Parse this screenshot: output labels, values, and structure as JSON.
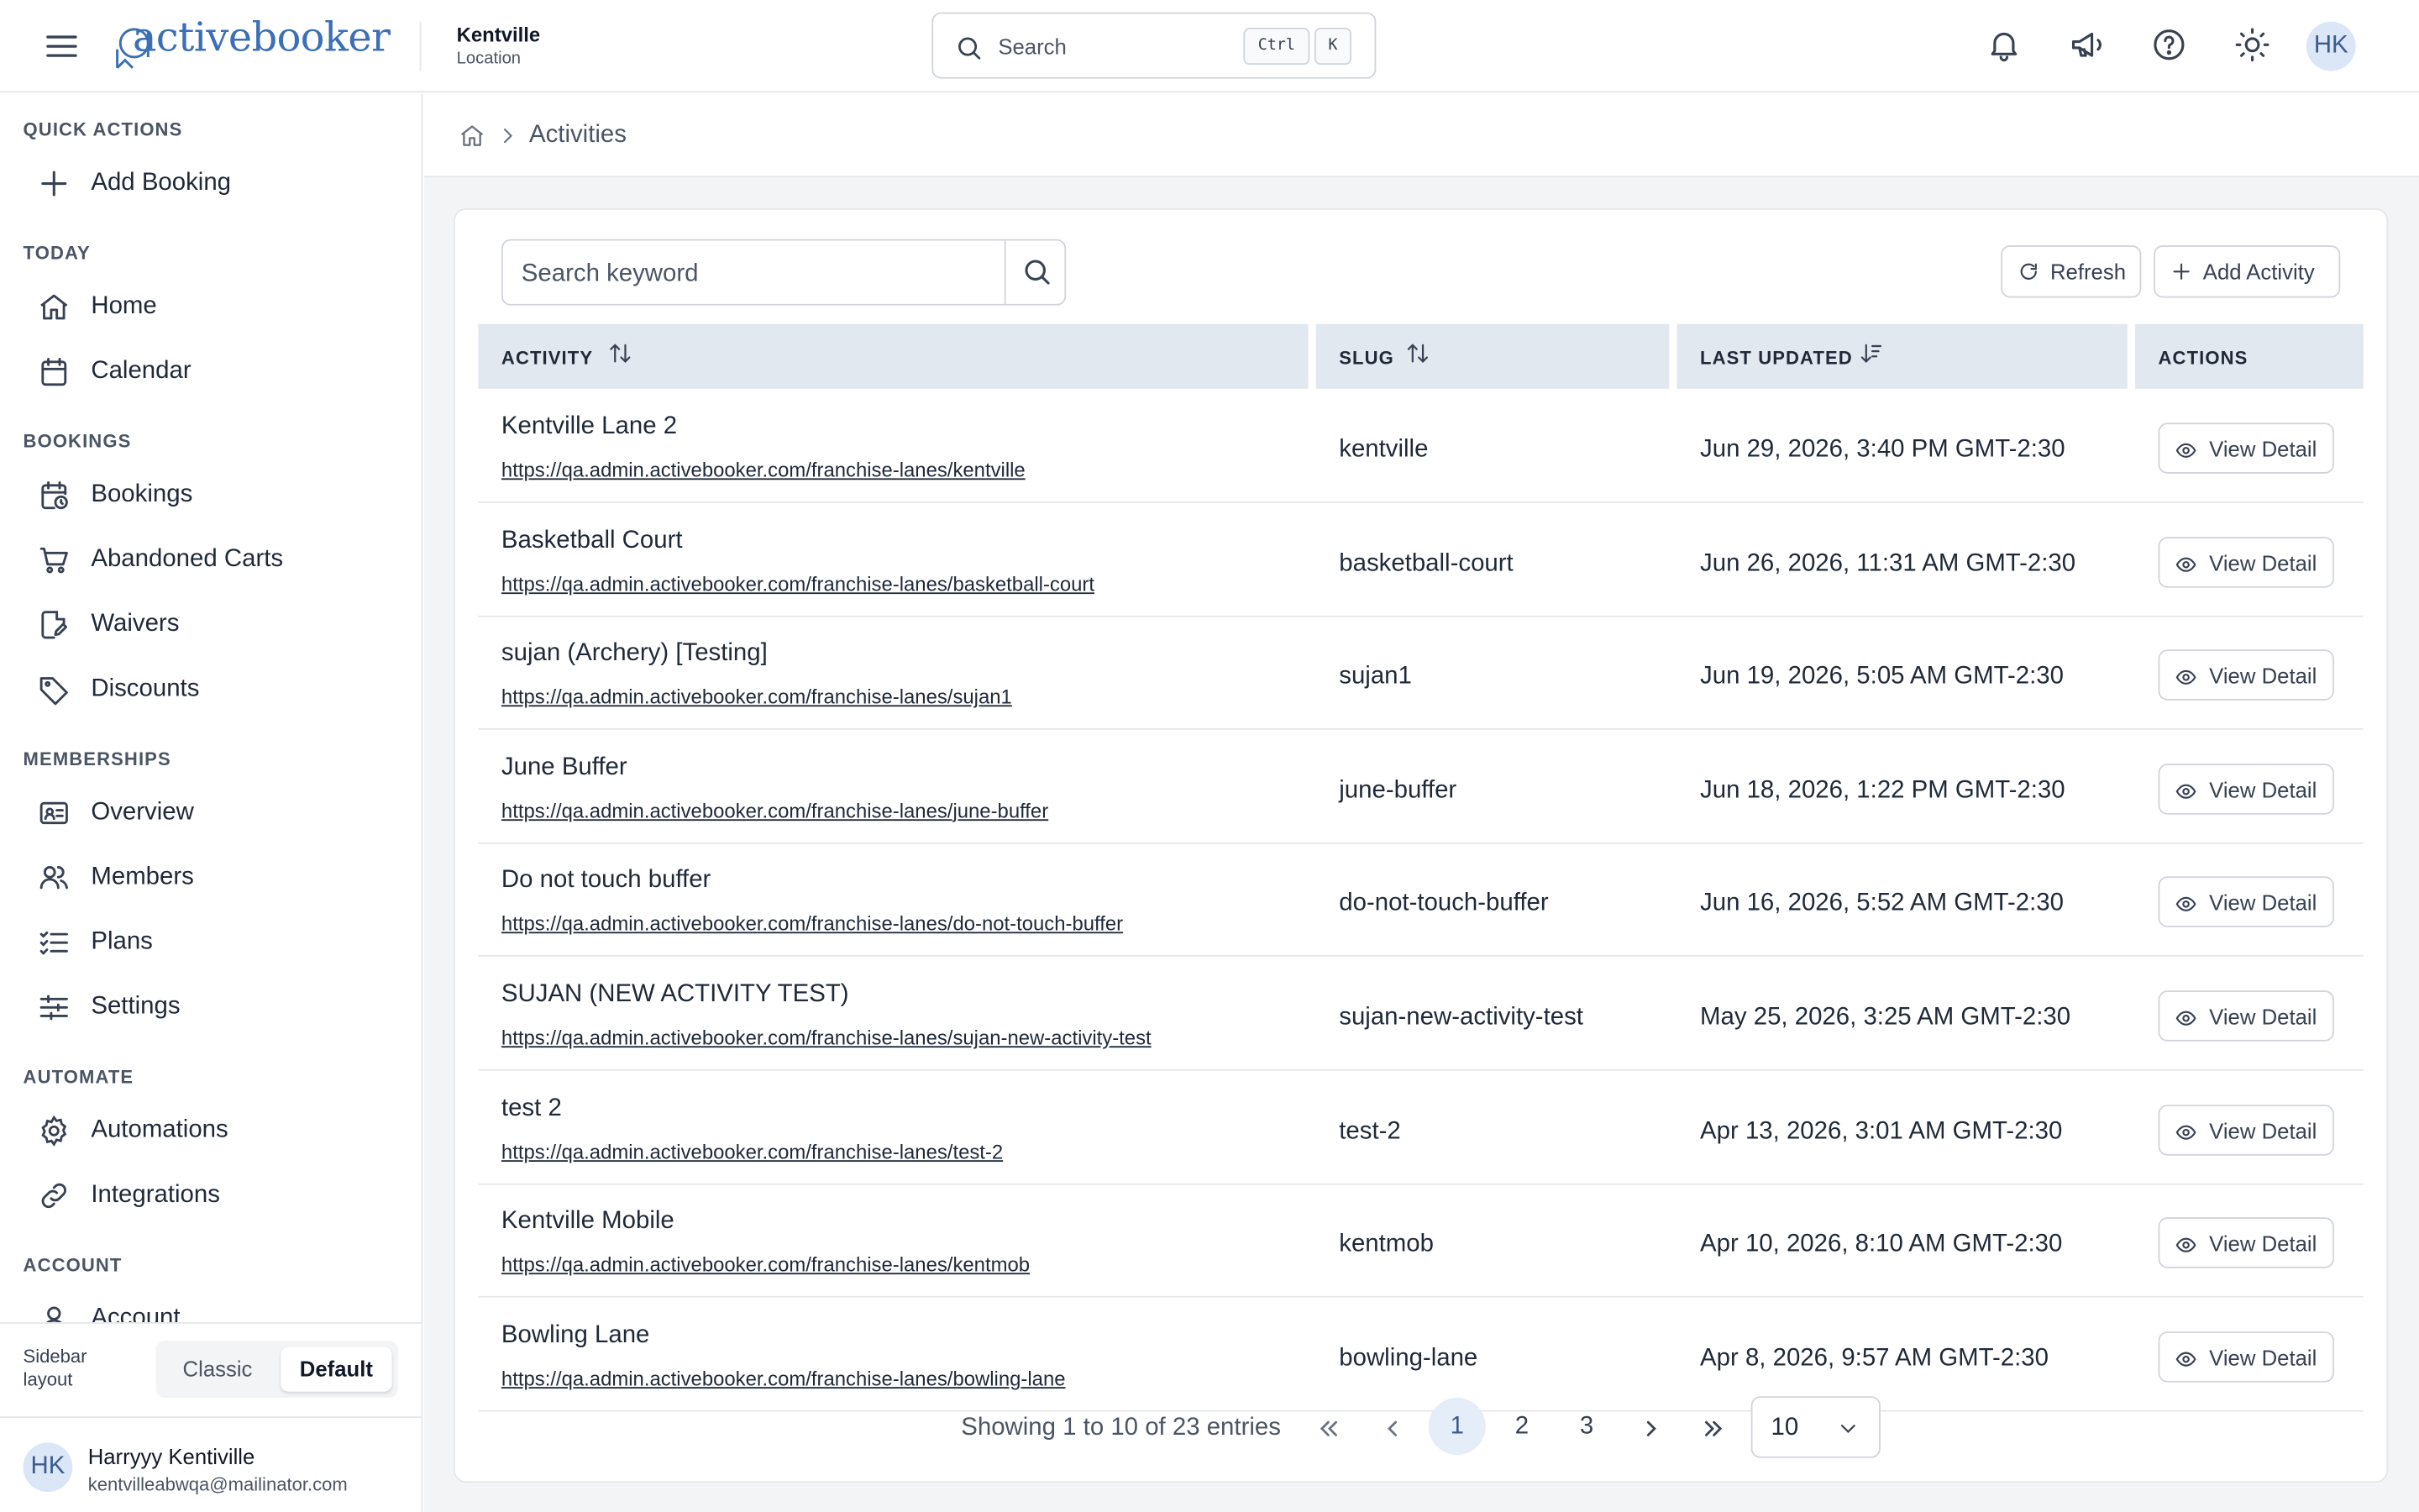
{
  "header": {
    "logo_text": "activebooker",
    "location_name": "Kentville",
    "location_label": "Location",
    "search_placeholder": "Search",
    "shortcut_ctrl": "Ctrl",
    "shortcut_key": "K",
    "avatar_initials": "HK"
  },
  "sidebar": {
    "sections": {
      "quick_actions": "QUICK ACTIONS",
      "today": "TODAY",
      "bookings": "BOOKINGS",
      "memberships": "MEMBERSHIPS",
      "automate": "AUTOMATE",
      "account": "ACCOUNT"
    },
    "items": {
      "add_booking": "Add Booking",
      "home": "Home",
      "calendar": "Calendar",
      "bookings": "Bookings",
      "abandoned_carts": "Abandoned Carts",
      "waivers": "Waivers",
      "discounts": "Discounts",
      "overview": "Overview",
      "members": "Members",
      "plans": "Plans",
      "settings": "Settings",
      "automations": "Automations",
      "integrations": "Integrations",
      "account": "Account"
    },
    "layout": {
      "label": "Sidebar layout",
      "options": [
        "Classic",
        "Default"
      ],
      "selected": "Default"
    },
    "user": {
      "initials": "HK",
      "name": "Harryyy Kentiville",
      "email": "kentvilleabwqa@mailinator.com"
    }
  },
  "breadcrumb": {
    "current": "Activities"
  },
  "toolbar": {
    "keyword_placeholder": "Search keyword",
    "refresh_label": "Refresh",
    "add_activity_label": "Add Activity"
  },
  "table": {
    "columns": [
      "ACTIVITY",
      "SLUG",
      "LAST UPDATED",
      "ACTIONS"
    ],
    "action_label": "View Detail",
    "rows": [
      {
        "name": "Kentville Lane 2",
        "url": "https://qa.admin.activebooker.com/franchise-lanes/kentville",
        "slug": "kentville",
        "updated": "Jun 29, 2026, 3:40 PM GMT-2:30"
      },
      {
        "name": "Basketball Court",
        "url": "https://qa.admin.activebooker.com/franchise-lanes/basketball-court",
        "slug": "basketball-court",
        "updated": "Jun 26, 2026, 11:31 AM GMT-2:30"
      },
      {
        "name": "sujan (Archery) [Testing]",
        "url": "https://qa.admin.activebooker.com/franchise-lanes/sujan1",
        "slug": "sujan1",
        "updated": "Jun 19, 2026, 5:05 AM GMT-2:30"
      },
      {
        "name": "June Buffer",
        "url": "https://qa.admin.activebooker.com/franchise-lanes/june-buffer",
        "slug": "june-buffer",
        "updated": "Jun 18, 2026, 1:22 PM GMT-2:30"
      },
      {
        "name": "Do not touch buffer",
        "url": "https://qa.admin.activebooker.com/franchise-lanes/do-not-touch-buffer",
        "slug": "do-not-touch-buffer",
        "updated": "Jun 16, 2026, 5:52 AM GMT-2:30"
      },
      {
        "name": "SUJAN (NEW ACTIVITY TEST)",
        "url": "https://qa.admin.activebooker.com/franchise-lanes/sujan-new-activity-test",
        "slug": "sujan-new-activity-test",
        "updated": "May 25, 2026, 3:25 AM GMT-2:30"
      },
      {
        "name": "test 2",
        "url": "https://qa.admin.activebooker.com/franchise-lanes/test-2",
        "slug": "test-2",
        "updated": "Apr 13, 2026, 3:01 AM GMT-2:30"
      },
      {
        "name": "Kentville Mobile",
        "url": "https://qa.admin.activebooker.com/franchise-lanes/kentmob",
        "slug": "kentmob",
        "updated": "Apr 10, 2026, 8:10 AM GMT-2:30"
      },
      {
        "name": "Bowling Lane",
        "url": "https://qa.admin.activebooker.com/franchise-lanes/bowling-lane",
        "slug": "bowling-lane",
        "updated": "Apr 8, 2026, 9:57 AM GMT-2:30"
      }
    ]
  },
  "pagination": {
    "info": "Showing 1 to 10 of 23 entries",
    "pages": [
      "1",
      "2",
      "3"
    ],
    "current_page": "1",
    "page_size": "10"
  },
  "colors": {
    "brand": "#3b6fb6",
    "table_header_bg": "#e2e8f0",
    "active_page_bg": "#e5edf8"
  }
}
